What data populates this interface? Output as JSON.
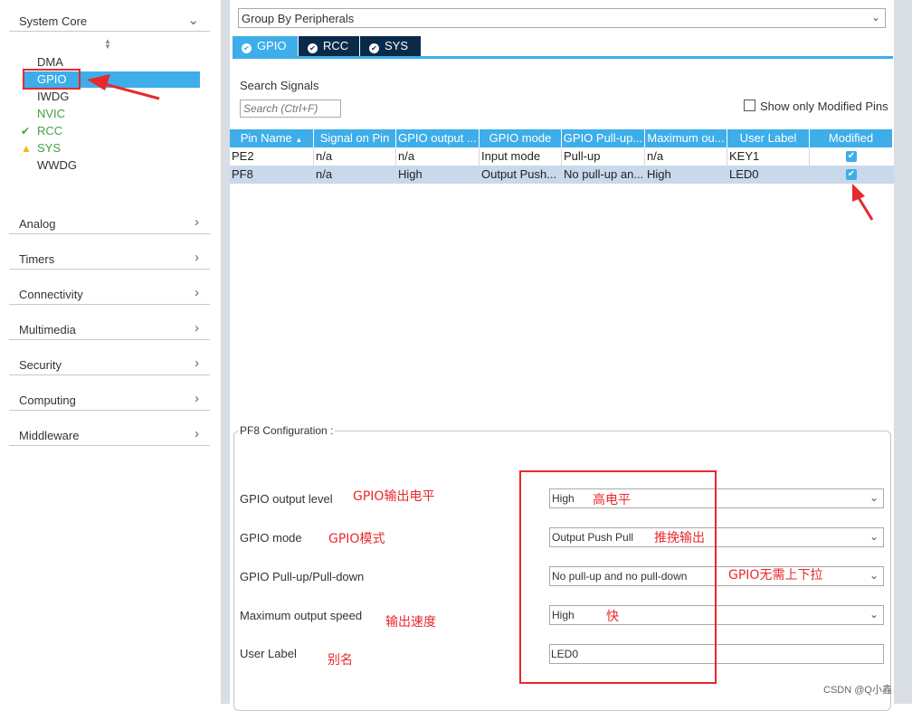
{
  "sidebar": {
    "system_core": "System Core",
    "core_items": [
      "DMA",
      "GPIO",
      "IWDG",
      "NVIC",
      "RCC",
      "SYS",
      "WWDG"
    ],
    "categories": [
      "Analog",
      "Timers",
      "Connectivity",
      "Multimedia",
      "Security",
      "Computing",
      "Middleware"
    ]
  },
  "group_select": "Group By Peripherals",
  "tabs": [
    "GPIO",
    "RCC",
    "SYS"
  ],
  "search": {
    "label": "Search Signals",
    "placeholder": "Search (Ctrl+F)"
  },
  "show_modified": "Show only Modified Pins",
  "table": {
    "headers": [
      "Pin Name",
      "Signal on Pin",
      "GPIO output ...",
      "GPIO mode",
      "GPIO Pull-up...",
      "Maximum ou...",
      "User Label",
      "Modified"
    ],
    "rows": [
      [
        "PE2",
        "n/a",
        "n/a",
        "Input mode",
        "Pull-up",
        "n/a",
        "KEY1"
      ],
      [
        "PF8",
        "n/a",
        "High",
        "Output Push...",
        "No pull-up an...",
        "High",
        "LED0"
      ]
    ]
  },
  "config": {
    "legend": "PF8 Configuration :",
    "labels": [
      "GPIO output level",
      "GPIO mode",
      "GPIO Pull-up/Pull-down",
      "Maximum output speed",
      "User Label"
    ],
    "values": [
      "High",
      "Output Push Pull",
      "No pull-up and no pull-down",
      "High",
      "LED0"
    ]
  },
  "annotations": {
    "left": [
      "GPIO输出电平",
      "GPIO模式",
      "输出速度",
      "别名"
    ],
    "right": [
      "高电平",
      "推挽输出",
      "GPIO无需上下拉",
      "快"
    ]
  },
  "watermark": "CSDN @Q小鑫",
  "colors": {
    "accent": "#3daee9",
    "tab_dark": "#0a2a4a",
    "annotation_red": "#e8282d",
    "status_green": "#45a045",
    "warning_yellow": "#f0c000"
  }
}
